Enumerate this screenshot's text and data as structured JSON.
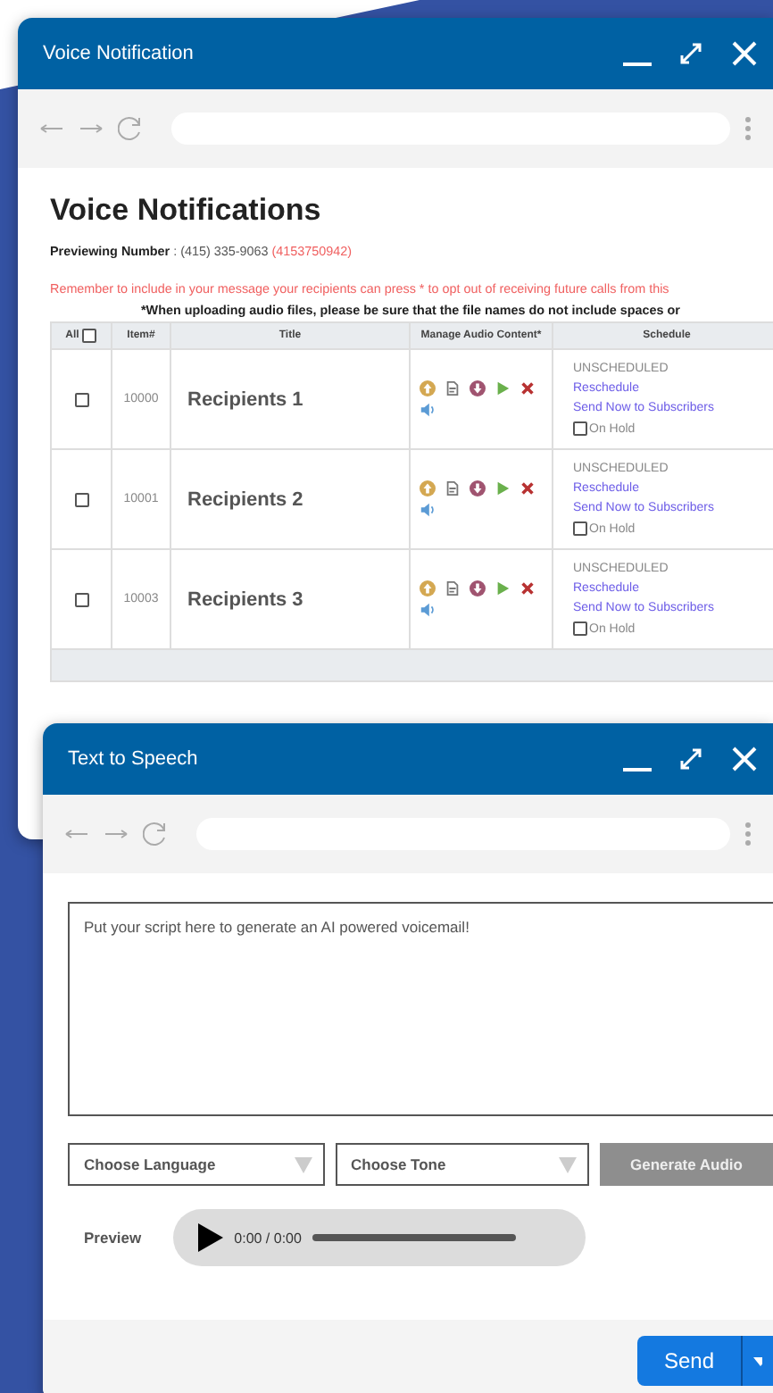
{
  "voice_window": {
    "title": "Voice Notification",
    "page_title": "Voice Notifications",
    "previewing_label": "Previewing Number",
    "previewing_separator": ":",
    "previewing_number": "(415) 335-9063",
    "previewing_alt": "(4153750942)",
    "reminder": "Remember to include in your message your recipients can press * to opt out of receiving future calls from this",
    "upload_note": "*When uploading audio files, please be sure that the file names do not include spaces or",
    "table": {
      "all_label": "All",
      "all_checked": false,
      "columns": [
        "Item#",
        "Title",
        "Manage Audio Content*",
        "Schedule"
      ],
      "rows": [
        {
          "checked": false,
          "item": "10000",
          "title": "Recipients 1",
          "status": "UNSCHEDULED",
          "reschedule": "Reschedule",
          "send_now": "Send Now to Subscribers",
          "on_hold_label": "On Hold",
          "on_hold": false
        },
        {
          "checked": false,
          "item": "10001",
          "title": "Recipients 2",
          "status": "UNSCHEDULED",
          "reschedule": "Reschedule",
          "send_now": "Send Now to Subscribers",
          "on_hold_label": "On Hold",
          "on_hold": false
        },
        {
          "checked": false,
          "item": "10003",
          "title": "Recipients 3",
          "status": "UNSCHEDULED",
          "reschedule": "Reschedule",
          "send_now": "Send Now to Subscribers",
          "on_hold_label": "On Hold",
          "on_hold": false
        }
      ]
    }
  },
  "tts_window": {
    "title": "Text to Speech",
    "script_placeholder": "Put your script here to generate an AI powered voicemail!",
    "language_placeholder": "Choose Language",
    "tone_placeholder": "Choose Tone",
    "generate_button": "Generate Audio",
    "preview_label": "Preview",
    "time": "0:00 / 0:00",
    "send_button": "Send"
  }
}
